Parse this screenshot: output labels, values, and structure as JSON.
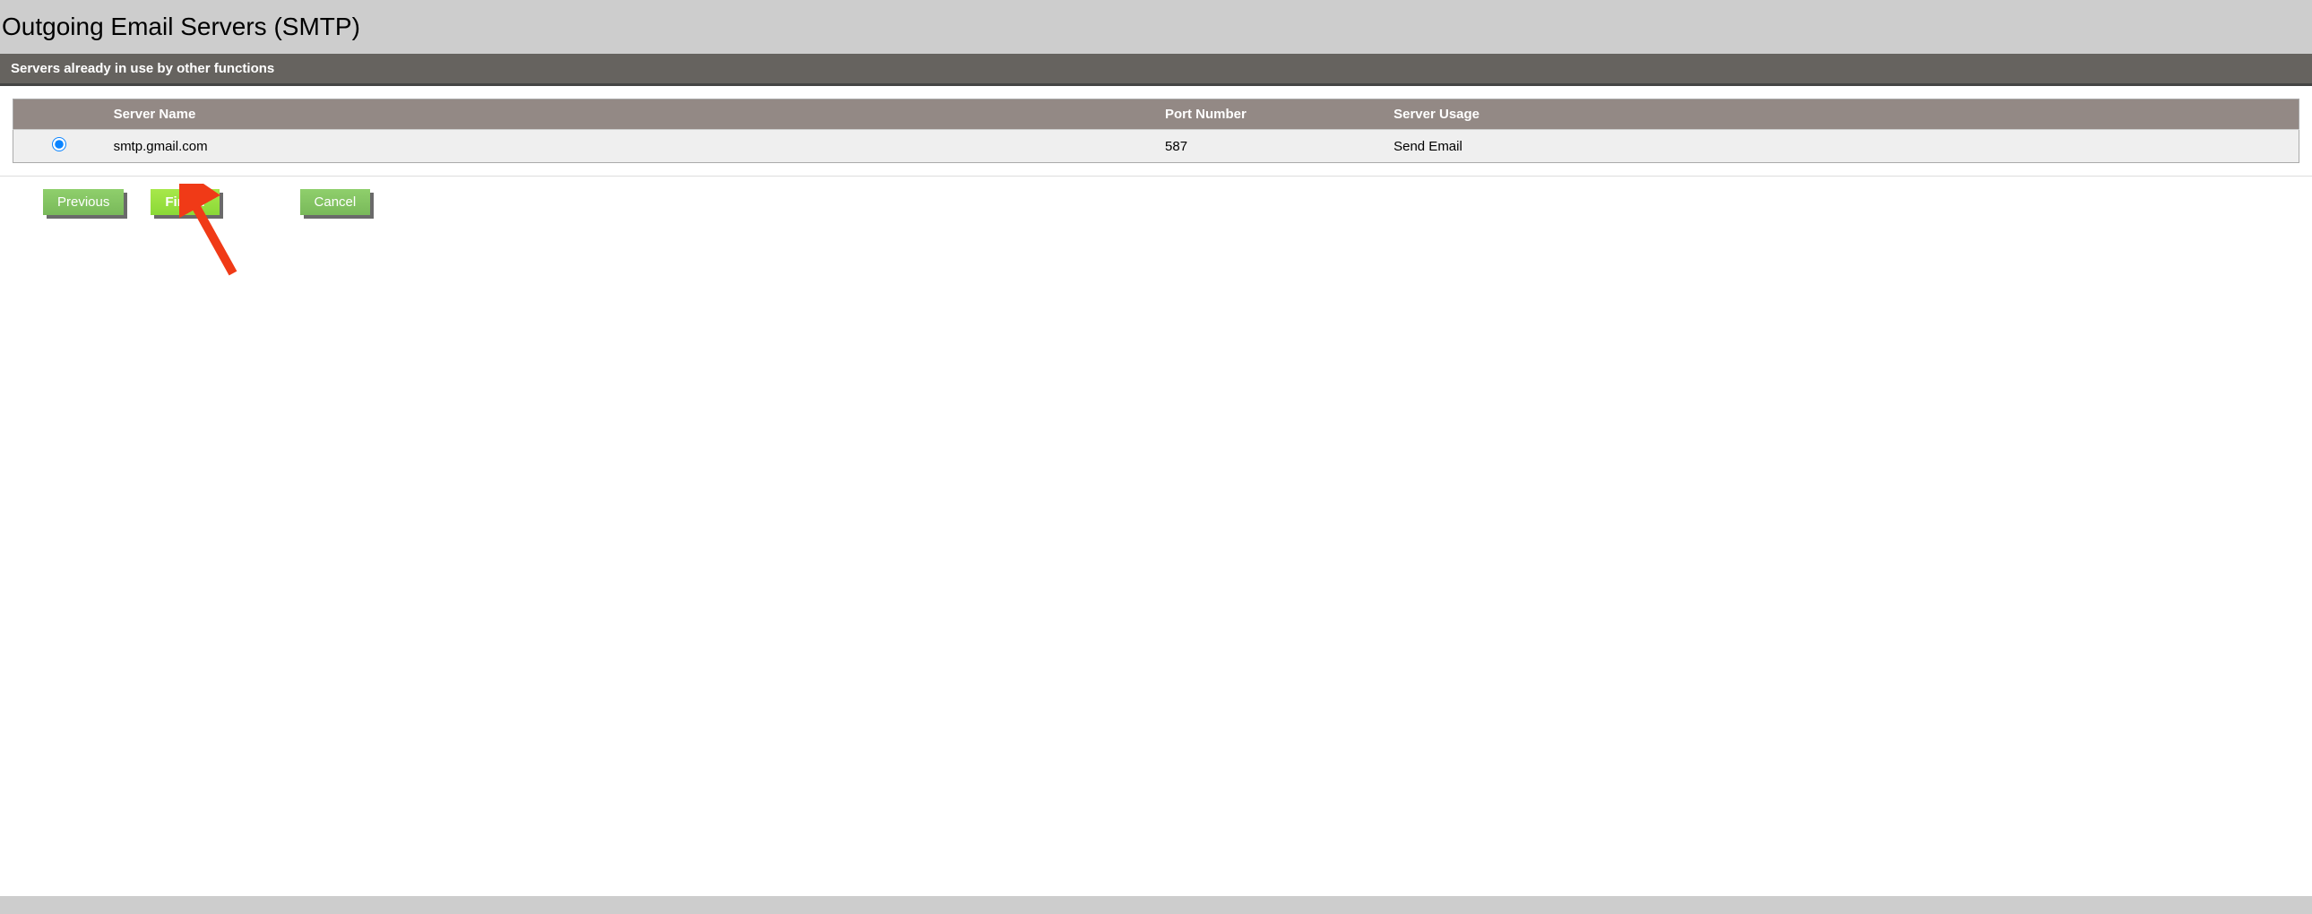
{
  "page": {
    "title": "Outgoing Email Servers (SMTP)",
    "subheader": "Servers already in use by other functions"
  },
  "table": {
    "headers": {
      "name": "Server Name",
      "port": "Port Number",
      "usage": "Server Usage"
    },
    "rows": [
      {
        "selected": true,
        "name": "smtp.gmail.com",
        "port": "587",
        "usage": "Send Email"
      }
    ]
  },
  "buttons": {
    "previous": "Previous",
    "finish": "Finish",
    "cancel": "Cancel"
  }
}
